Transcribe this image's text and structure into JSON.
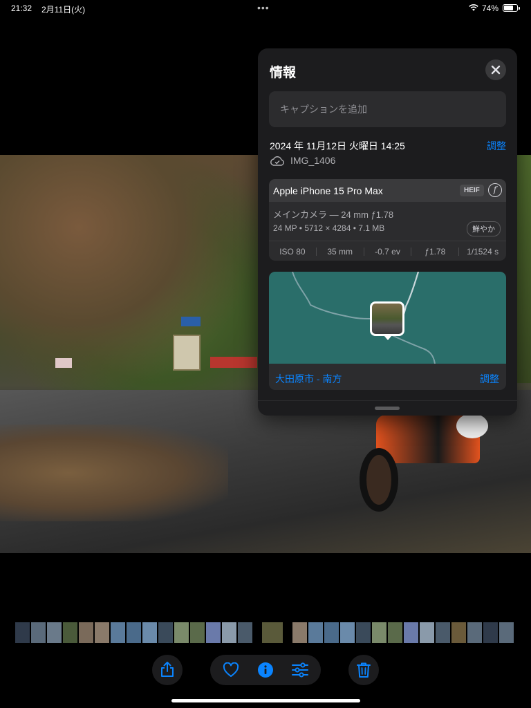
{
  "status_bar": {
    "time": "21:32",
    "date": "2月11日(火)",
    "battery_percent": "74%",
    "battery_level": 0.74
  },
  "info_panel": {
    "title": "情報",
    "caption_placeholder": "キャプションを追加",
    "datetime": "2024 年 11月12日 火曜日 14:25",
    "adjust_label": "調整",
    "filename": "IMG_1406",
    "device": {
      "model": "Apple iPhone 15 Pro Max",
      "format_badge": "HEIF",
      "lens": "メインカメラ — 24 mm ƒ1.78",
      "specs": "24 MP • 5712 × 4284 • 7.1 MB",
      "photo_style": "鮮やか",
      "exif": {
        "iso": "ISO 80",
        "focal": "35 mm",
        "ev": "-0.7 ev",
        "aperture": "ƒ1.78",
        "shutter": "1/1524 s"
      }
    },
    "location": {
      "name": "大田原市 - 南方",
      "adjust_label": "調整"
    }
  },
  "colors": {
    "accent": "#0a84ff",
    "panel_bg": "#1c1c1e",
    "card_bg": "#2c2c2e",
    "map_water": "#2a6e6a"
  },
  "toolbar": {
    "icons": [
      "share-icon",
      "heart-icon",
      "info-icon",
      "adjust-icon",
      "trash-icon"
    ]
  }
}
